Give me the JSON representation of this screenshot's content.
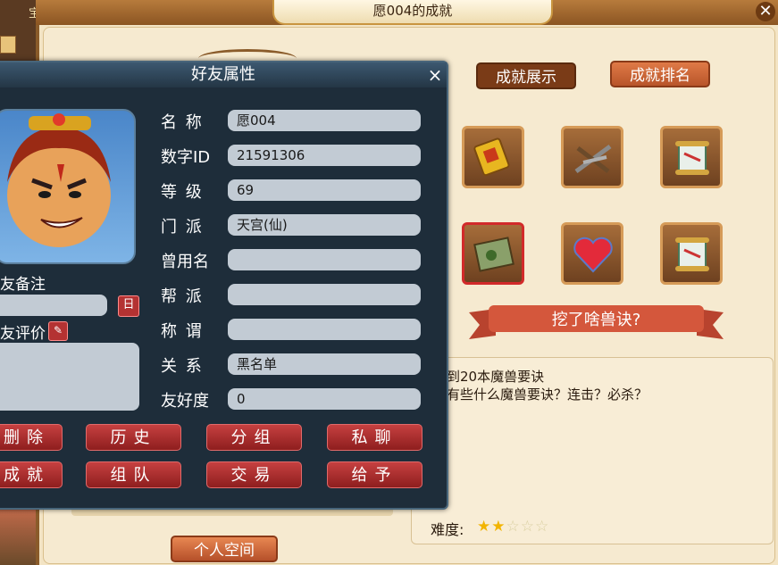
{
  "left_strip": {
    "char": "宝"
  },
  "achievement_window": {
    "title": "愿004的成就",
    "close": "✕",
    "tabs": {
      "display": "成就展示",
      "ranking": "成就排名"
    },
    "selected_item": "挖了啥兽诀?",
    "description": [
      "到20本魔兽要诀",
      "有些什么魔兽要诀？连击？必杀？"
    ],
    "difficulty_label": "难度:",
    "difficulty": {
      "stars_filled": 2,
      "stars_total": 5
    },
    "personal_space_button": "个人空间"
  },
  "friend_panel": {
    "title": "好友属性",
    "close": "×",
    "fields": {
      "name": {
        "label": "名  称",
        "value": "愿004"
      },
      "digital_id": {
        "label": "数字ID",
        "value": "21591306"
      },
      "level": {
        "label": "等  级",
        "value": "69"
      },
      "sect": {
        "label": "门  派",
        "value": "天宫(仙)"
      },
      "former_name": {
        "label": "曾用名",
        "value": ""
      },
      "guild": {
        "label": "帮  派",
        "value": ""
      },
      "title": {
        "label": "称  谓",
        "value": ""
      },
      "relation": {
        "label": "关  系",
        "value": "黑名单"
      },
      "friendship": {
        "label": "友好度",
        "value": "0"
      }
    },
    "note_label": "友备注",
    "evaluation_label": "友评价",
    "buttons": {
      "delete": "删除",
      "history": "历史",
      "group": "分组",
      "private_chat": "私聊",
      "achievement": "成就",
      "team": "组队",
      "trade": "交易",
      "give": "给予"
    }
  }
}
